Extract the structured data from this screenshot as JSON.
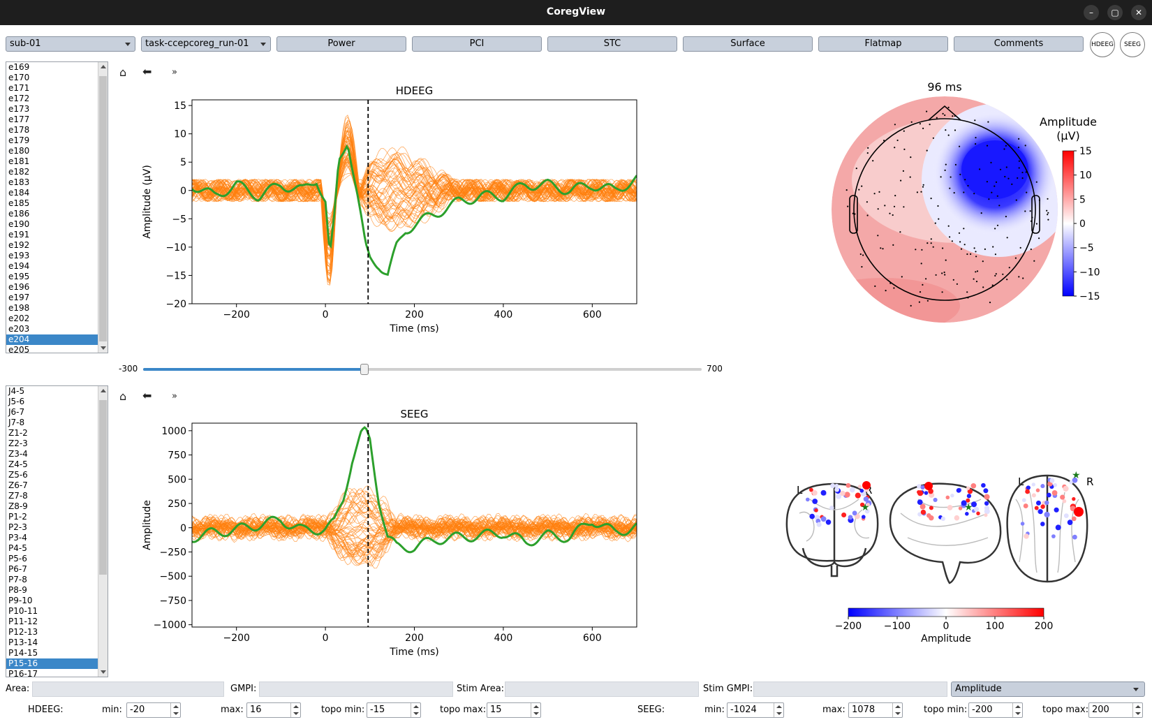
{
  "window": {
    "title": "CoregView"
  },
  "toolbar": {
    "subject": "sub-01",
    "task": "task-ccepcoreg_run-01",
    "buttons": [
      "Power",
      "PCI",
      "STC",
      "Surface",
      "Flatmap",
      "Comments"
    ],
    "hdeeg_btn": "HDEEG",
    "seeg_btn": "SEEG"
  },
  "hdeeg_channels": {
    "items": [
      "e169",
      "e170",
      "e171",
      "e172",
      "e173",
      "e177",
      "e178",
      "e179",
      "e180",
      "e181",
      "e182",
      "e183",
      "e184",
      "e185",
      "e186",
      "e190",
      "e191",
      "e192",
      "e193",
      "e194",
      "e195",
      "e196",
      "e197",
      "e198",
      "e202",
      "e203",
      "e204",
      "e205"
    ],
    "selected": "e204"
  },
  "seeg_channels": {
    "items": [
      "J4-5",
      "J5-6",
      "J6-7",
      "J7-8",
      "Z1-2",
      "Z2-3",
      "Z3-4",
      "Z4-5",
      "Z5-6",
      "Z6-7",
      "Z7-8",
      "Z8-9",
      "P1-2",
      "P2-3",
      "P3-4",
      "P4-5",
      "P5-6",
      "P6-7",
      "P7-8",
      "P8-9",
      "P9-10",
      "P10-11",
      "P11-12",
      "P12-13",
      "P13-14",
      "P14-15",
      "P15-16",
      "P16-17"
    ],
    "selected": "P15-16"
  },
  "nav": {
    "more": "»"
  },
  "slider": {
    "min": "-300",
    "max": "700",
    "value": 96
  },
  "topo": {
    "title": "96 ms",
    "cbar_label": "Amplitude\n(µV)",
    "cbar_ticks": [
      "15",
      "10",
      "5",
      "0",
      "−5",
      "−10",
      "−15"
    ]
  },
  "glass": {
    "L": "L",
    "R": "R",
    "cbar_label": "Amplitude",
    "cbar_ticks": [
      "−200",
      "−100",
      "0",
      "100",
      "200"
    ]
  },
  "colors": {
    "butterfly": "#ff7f0e",
    "selected": "#2ca02c",
    "cursor": "#000000"
  },
  "chart_data": [
    {
      "type": "line",
      "title": "HDEEG",
      "xlabel": "Time (ms)",
      "ylabel": "Amplitude (µV)",
      "xlim": [
        -300,
        700
      ],
      "ylim": [
        -20,
        16
      ],
      "xticks": [
        -200,
        0,
        200,
        400,
        600
      ],
      "yticks": [
        15,
        10,
        5,
        0,
        -5,
        -10,
        -15,
        -20
      ],
      "cursor_x": 96,
      "series": [
        {
          "name": "e204",
          "x": [
            -300,
            -250,
            -200,
            -150,
            -100,
            -50,
            -20,
            0,
            10,
            20,
            30,
            50,
            70,
            90,
            100,
            120,
            140,
            160,
            180,
            200,
            250,
            300,
            350,
            400,
            450,
            500,
            550,
            600,
            650,
            700
          ],
          "y": [
            1,
            -1,
            1,
            -1,
            1,
            0,
            2,
            -2,
            -12,
            -5,
            5,
            9,
            0,
            -10,
            -12,
            -13,
            -15,
            -10,
            -7,
            -6,
            -4,
            -2,
            -1,
            -1,
            1,
            1,
            0,
            1,
            0,
            2
          ]
        }
      ]
    },
    {
      "type": "line",
      "title": "SEEG",
      "xlabel": "Time (ms)",
      "ylabel": "Amplitude",
      "xlim": [
        -300,
        700
      ],
      "ylim": [
        -1024,
        1078
      ],
      "xticks": [
        -200,
        0,
        200,
        400,
        600
      ],
      "yticks": [
        1000,
        750,
        500,
        250,
        0,
        -250,
        -500,
        -750,
        -1000
      ],
      "cursor_x": 96,
      "series": [
        {
          "name": "P15-16",
          "x": [
            -300,
            -250,
            -200,
            -150,
            -100,
            -50,
            0,
            20,
            40,
            60,
            80,
            90,
            100,
            120,
            140,
            160,
            200,
            250,
            300,
            350,
            400,
            450,
            500,
            550,
            600,
            650,
            700
          ],
          "y": [
            -100,
            -50,
            -20,
            30,
            80,
            -30,
            -10,
            50,
            300,
            700,
            950,
            990,
            900,
            300,
            -100,
            -200,
            -200,
            -120,
            -100,
            -80,
            -50,
            -150,
            -80,
            -100,
            80,
            -50,
            10
          ]
        }
      ]
    }
  ],
  "footer": {
    "area_label": "Area:",
    "gmpi_label": "GMPI:",
    "stim_area_label": "Stim Area:",
    "stim_gmpi_label": "Stim GMPI:",
    "mode": "Amplitude",
    "hdeeg_label": "HDEEG:",
    "seeg_label": "SEEG:",
    "min_label": "min:",
    "max_label": "max:",
    "topo_min_label": "topo min:",
    "topo_max_label": "topo max:",
    "hdeeg_min": "-20",
    "hdeeg_max": "16",
    "hdeeg_topo_min": "-15",
    "hdeeg_topo_max": "15",
    "seeg_min": "-1024",
    "seeg_max": "1078",
    "seeg_topo_min": "-200",
    "seeg_topo_max": "200"
  }
}
